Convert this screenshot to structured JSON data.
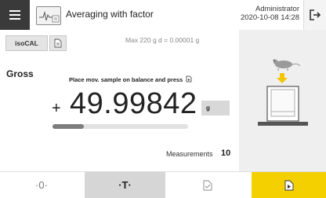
{
  "header": {
    "title": "Averaging with factor",
    "user": "Administrator",
    "datetime": "2020-10-08 14:28"
  },
  "toolbar": {
    "isocal_label": "isoCAL"
  },
  "balance": {
    "capacity": "Max 220 g   d = 0.00001 g",
    "mode_label": "Gross",
    "instruction": "Place mov. sample on balance and press",
    "sign": "+",
    "weight": "49.99842",
    "unit": "g",
    "progress_fraction": 0.23
  },
  "measurements": {
    "label": "Measurements",
    "value": "10"
  },
  "bottom": {
    "zero_label": "·0·",
    "tare_label": "·T·"
  },
  "colors": {
    "accent": "#f5d000",
    "menu_bg": "#3a3a3a",
    "right_panel_bg": "#efefef"
  },
  "icons": [
    "menu-icon",
    "app-icon",
    "logout-icon",
    "document-icon",
    "balance-illustration",
    "print-icon",
    "result-icon"
  ]
}
